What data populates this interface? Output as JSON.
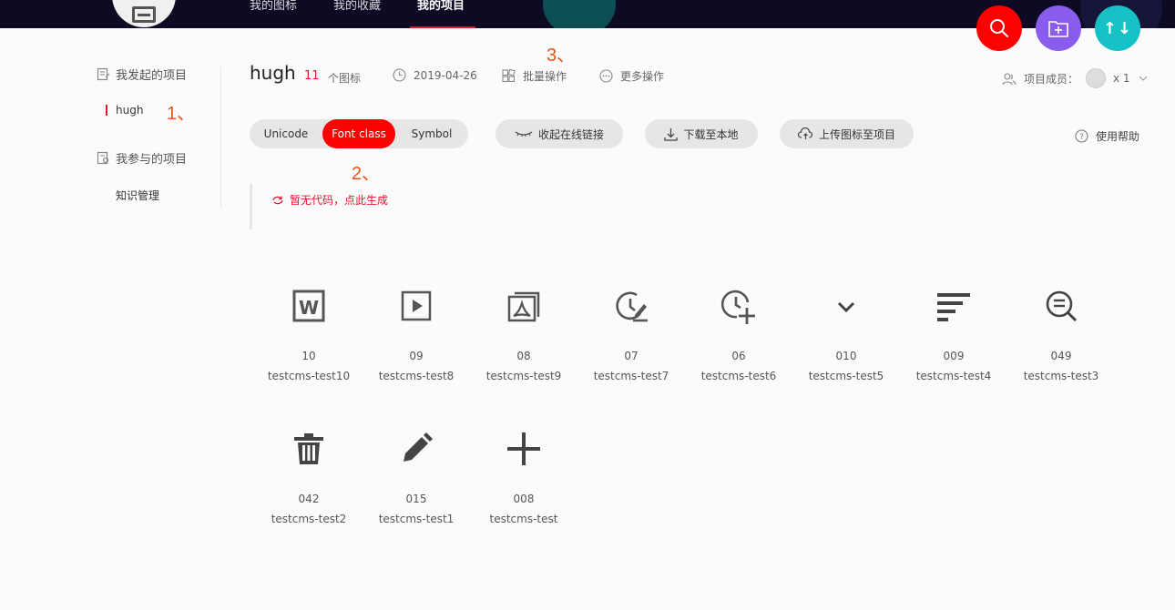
{
  "topnav": {
    "items": [
      "我的图标",
      "我的收藏",
      "我的项目"
    ],
    "active_index": 2
  },
  "sidebar": {
    "created_heading": "我发起的项目",
    "created_items": [
      "hugh"
    ],
    "joined_heading": "我参与的项目",
    "joined_items": [
      "知识管理"
    ]
  },
  "annotations": [
    "1、",
    "2、",
    "3、"
  ],
  "project": {
    "title": "hugh",
    "icon_count": "11",
    "icon_count_label": "个图标",
    "date": "2019-04-26",
    "batch_label": "批量操作",
    "more_label": "更多操作",
    "members_label": "项目成员：",
    "members_count": "x 1"
  },
  "tabs": [
    "Unicode",
    "Font class",
    "Symbol"
  ],
  "active_tab": "Font class",
  "actions": {
    "collapse_link": "收起在线链接",
    "download": "下载至本地",
    "upload": "上传图标至项目",
    "help": "使用帮助"
  },
  "code_hint": "暂无代码，点此生成",
  "icons": [
    {
      "code": "10",
      "name": "testcms-test10",
      "glyph": "word-icon"
    },
    {
      "code": "09",
      "name": "testcms-test8",
      "glyph": "play-box-icon"
    },
    {
      "code": "08",
      "name": "testcms-test9",
      "glyph": "pdf-icon"
    },
    {
      "code": "07",
      "name": "testcms-test7",
      "glyph": "clock-edit-icon"
    },
    {
      "code": "06",
      "name": "testcms-test6",
      "glyph": "clock-add-icon"
    },
    {
      "code": "010",
      "name": "testcms-test5",
      "glyph": "chevron-down-icon"
    },
    {
      "code": "009",
      "name": "testcms-test4",
      "glyph": "align-left-icon"
    },
    {
      "code": "049",
      "name": "testcms-test3",
      "glyph": "search-list-icon"
    },
    {
      "code": "042",
      "name": "testcms-test2",
      "glyph": "trash-icon"
    },
    {
      "code": "015",
      "name": "testcms-test1",
      "glyph": "pencil-icon"
    },
    {
      "code": "008",
      "name": "testcms-test",
      "glyph": "plus-icon"
    }
  ],
  "colors": {
    "accent": "#ff0000",
    "annotation": "#e8541a",
    "topbar": "#0d0b24",
    "fab_search": "#ff0000",
    "fab_folder": "#8a5ced",
    "fab_sort": "#15c1c4"
  }
}
